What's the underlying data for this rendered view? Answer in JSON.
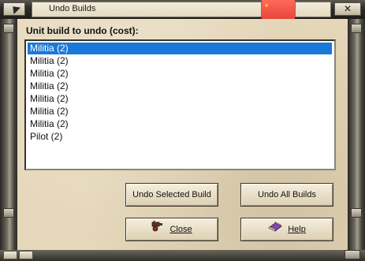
{
  "window": {
    "title": "Undo Builds"
  },
  "list": {
    "label": "Unit build to undo (cost):",
    "items": [
      "Militia (2)",
      "Militia (2)",
      "Militia (2)",
      "Militia (2)",
      "Militia (2)",
      "Militia (2)",
      "Militia (2)",
      "Pilot (2)"
    ],
    "selected_index": 0
  },
  "buttons": {
    "undo_selected": "Undo Selected Build",
    "undo_all": "Undo All Builds",
    "close": "Close",
    "help": "Help"
  },
  "colors": {
    "selection": "#1a78d8",
    "parchment": "#e5d7b9",
    "flag": "#e8453a"
  },
  "icons": {
    "window_menu": "corner-arrow-icon",
    "flag": "flag-icon",
    "window_close": "close-icon",
    "close_button": "cannon-icon",
    "help_button": "book-icon"
  }
}
